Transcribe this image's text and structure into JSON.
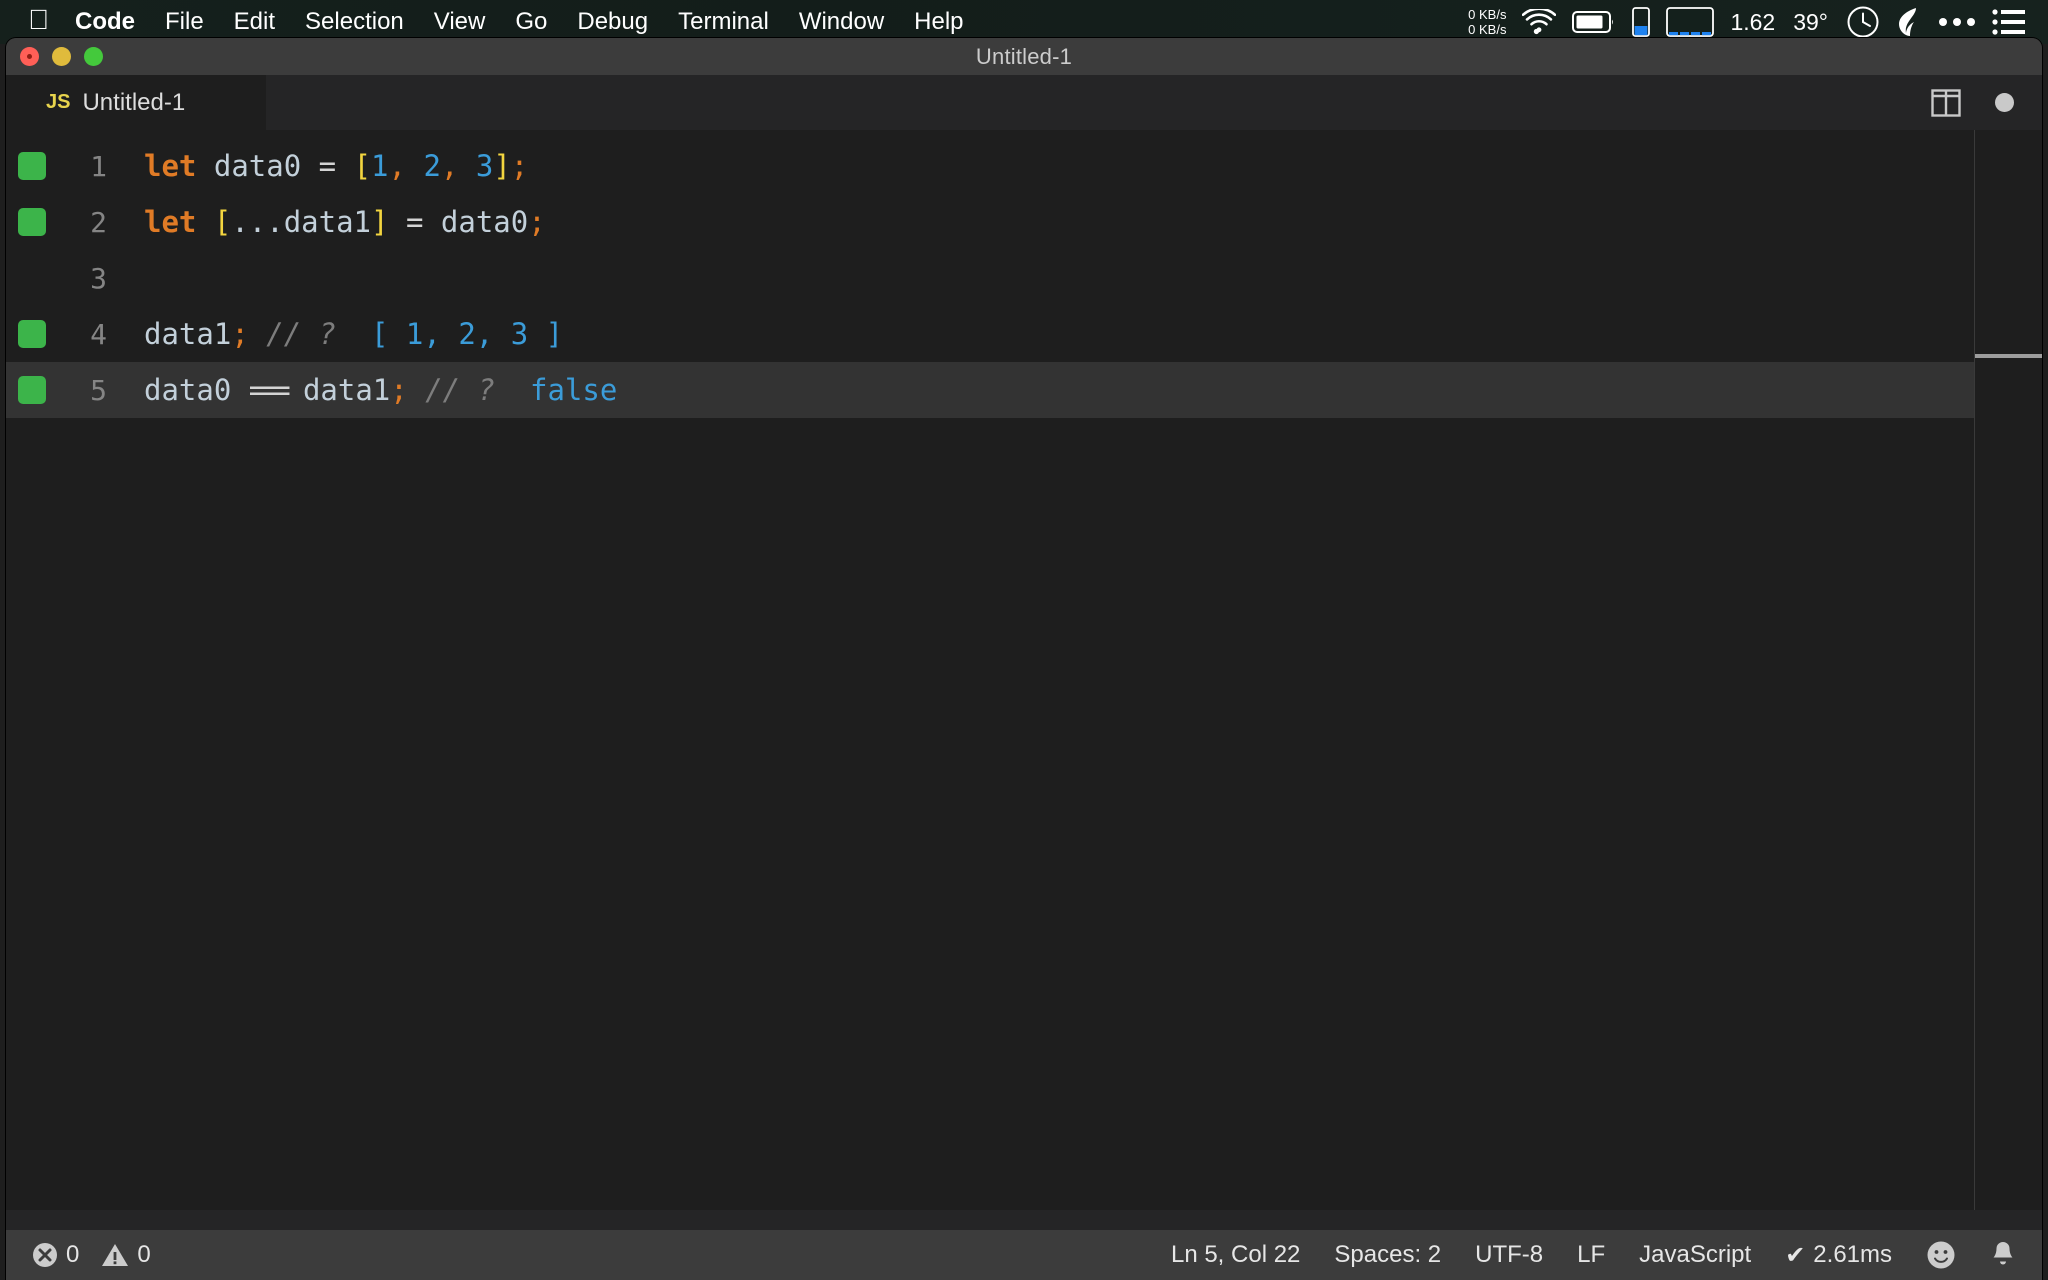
{
  "menubar": {
    "apple_icon": "apple-logo-icon",
    "items": [
      {
        "label": "Code",
        "bold": true
      },
      {
        "label": "File",
        "bold": false
      },
      {
        "label": "Edit",
        "bold": false
      },
      {
        "label": "Selection",
        "bold": false
      },
      {
        "label": "View",
        "bold": false
      },
      {
        "label": "Go",
        "bold": false
      },
      {
        "label": "Debug",
        "bold": false
      },
      {
        "label": "Terminal",
        "bold": false
      },
      {
        "label": "Window",
        "bold": false
      },
      {
        "label": "Help",
        "bold": false
      }
    ],
    "status": {
      "net_up": "0 KB/s",
      "net_down": "0 KB/s",
      "wifi_icon": "wifi-icon",
      "battery_icon": "battery-icon",
      "memory_icon": "memory-gauge-icon",
      "cpu_graph_icon": "cpu-history-graph-icon",
      "load_average": "1.62",
      "temperature": "39°",
      "clock_icon": "clock-icon",
      "app_icon": "leaf-icon",
      "ellipsis_icon": "ellipsis-icon",
      "control_center_icon": "list-menu-icon"
    }
  },
  "window": {
    "title": "Untitled-1",
    "traffic_lights": [
      "close-button",
      "minimize-button",
      "zoom-button"
    ]
  },
  "tabbar": {
    "tabs": [
      {
        "icon_label": "JS",
        "name": "Untitled-1",
        "active": true,
        "dirty": true
      }
    ],
    "actions": [
      {
        "name": "split-editor-right-button",
        "icon": "split-editor-icon"
      },
      {
        "name": "unsaved-indicator",
        "icon": "dirty-dot-icon"
      }
    ]
  },
  "editor": {
    "language": "JavaScript",
    "lines": [
      {
        "number": "1",
        "covered": true,
        "current": false,
        "tokens": [
          {
            "t": "let",
            "c": "kw"
          },
          {
            "t": " ",
            "c": "op"
          },
          {
            "t": "data0",
            "c": "id"
          },
          {
            "t": " ",
            "c": "op"
          },
          {
            "t": "=",
            "c": "op"
          },
          {
            "t": " ",
            "c": "op"
          },
          {
            "t": "[",
            "c": "brk"
          },
          {
            "t": "1",
            "c": "num"
          },
          {
            "t": ",",
            "c": "punc"
          },
          {
            "t": " ",
            "c": "op"
          },
          {
            "t": "2",
            "c": "num"
          },
          {
            "t": ",",
            "c": "punc"
          },
          {
            "t": " ",
            "c": "op"
          },
          {
            "t": "3",
            "c": "num"
          },
          {
            "t": "]",
            "c": "brk"
          },
          {
            "t": ";",
            "c": "punc"
          }
        ]
      },
      {
        "number": "2",
        "covered": true,
        "current": false,
        "tokens": [
          {
            "t": "let",
            "c": "kw"
          },
          {
            "t": " ",
            "c": "op"
          },
          {
            "t": "[",
            "c": "brk"
          },
          {
            "t": "...",
            "c": "id"
          },
          {
            "t": "data1",
            "c": "id"
          },
          {
            "t": "]",
            "c": "brk"
          },
          {
            "t": " ",
            "c": "op"
          },
          {
            "t": "=",
            "c": "op"
          },
          {
            "t": " ",
            "c": "op"
          },
          {
            "t": "data0",
            "c": "id"
          },
          {
            "t": ";",
            "c": "punc"
          }
        ]
      },
      {
        "number": "3",
        "covered": false,
        "current": false,
        "tokens": []
      },
      {
        "number": "4",
        "covered": true,
        "current": false,
        "tokens": [
          {
            "t": "data1",
            "c": "id"
          },
          {
            "t": ";",
            "c": "punc"
          },
          {
            "t": " ",
            "c": "op"
          },
          {
            "t": "// ?",
            "c": "cmt"
          },
          {
            "t": "  ",
            "c": "op"
          },
          {
            "t": "[ 1, 2, 3 ]",
            "c": "res"
          }
        ]
      },
      {
        "number": "5",
        "covered": true,
        "current": true,
        "tokens": [
          {
            "t": "data0",
            "c": "id"
          },
          {
            "t": " ",
            "c": "op"
          },
          {
            "t": "===",
            "c": "op eq3"
          },
          {
            "t": " ",
            "c": "op"
          },
          {
            "t": "data1",
            "c": "id"
          },
          {
            "t": ";",
            "c": "punc"
          },
          {
            "t": " ",
            "c": "op"
          },
          {
            "t": "// ?",
            "c": "cmt"
          },
          {
            "t": "  ",
            "c": "op"
          },
          {
            "t": "false",
            "c": "res"
          }
        ]
      }
    ]
  },
  "statusbar": {
    "errors": "0",
    "warnings": "0",
    "cursor": "Ln 5, Col 22",
    "indentation": "Spaces: 2",
    "encoding": "UTF-8",
    "eol": "LF",
    "language": "JavaScript",
    "runtime": "2.61ms",
    "runtime_check": "✔",
    "feedback_icon": "smiley-icon",
    "notifications_icon": "bell-icon"
  },
  "colors": {
    "editor_background": "#1e1e1e",
    "keyword": "#e07b26",
    "number": "#3b9cd9",
    "bracket": "#f3d53f",
    "comment": "#7d7d7d",
    "inline_result": "#3b9cd9",
    "coverage_green": "#3cb44a",
    "statusbar_background": "#3c3c3c"
  }
}
